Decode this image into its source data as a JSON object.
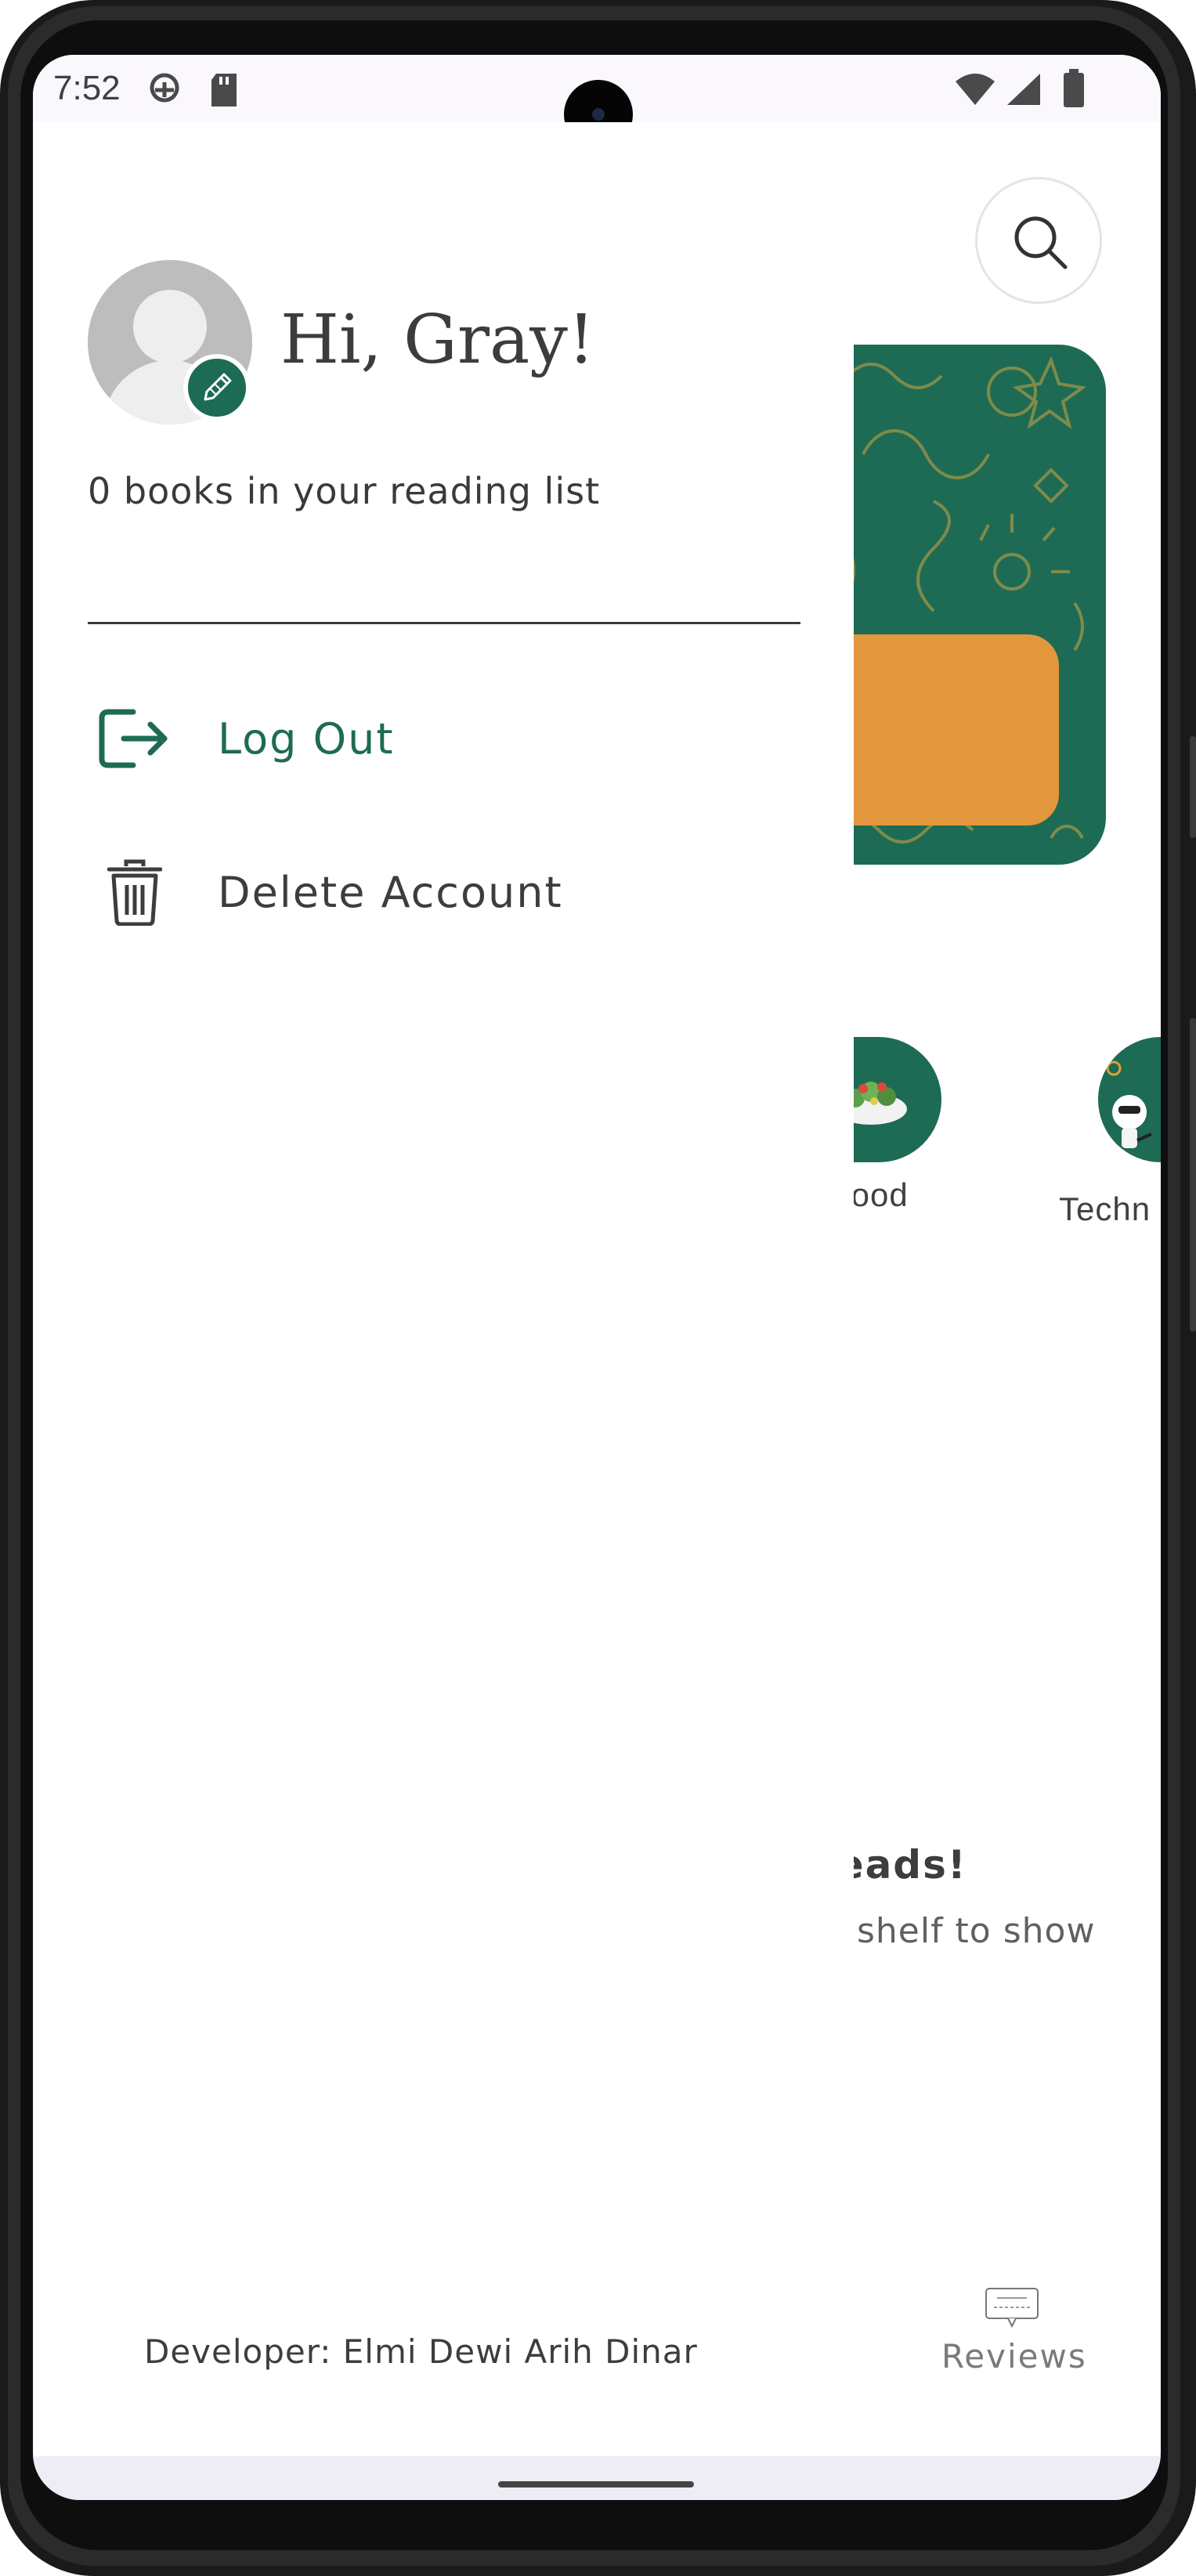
{
  "status_bar": {
    "time": "7:52",
    "left_icons": [
      "data-saver-icon",
      "sd-card-icon"
    ],
    "right_icons": [
      "wifi-icon",
      "cellular-signal-icon",
      "battery-icon"
    ]
  },
  "drawer": {
    "greeting": "Hi, Gray!",
    "reading_list_text": "0 books in your reading list",
    "menu": [
      {
        "label": "Log Out",
        "icon": "logout-icon",
        "color": "#1d6b54"
      },
      {
        "label": "Delete Account",
        "icon": "trash-icon",
        "color": "#3d3d3d"
      }
    ],
    "developer": "Developer: Elmi Dewi Arih Dinar"
  },
  "background_page": {
    "search_icon": "search-icon",
    "categories": [
      {
        "label": "Food",
        "icon": "salad-bowl-icon"
      },
      {
        "label": "Techn",
        "icon": "robot-icon"
      }
    ],
    "empty_title": "reads!",
    "empty_subtitle": "w shelf to show",
    "bottom_nav": {
      "reviews_label": "Reviews",
      "reviews_icon": "review-card-icon"
    }
  },
  "colors": {
    "brand_green": "#1d6b54",
    "accent_orange": "#e3973c",
    "text_dark": "#3d3d3d"
  }
}
